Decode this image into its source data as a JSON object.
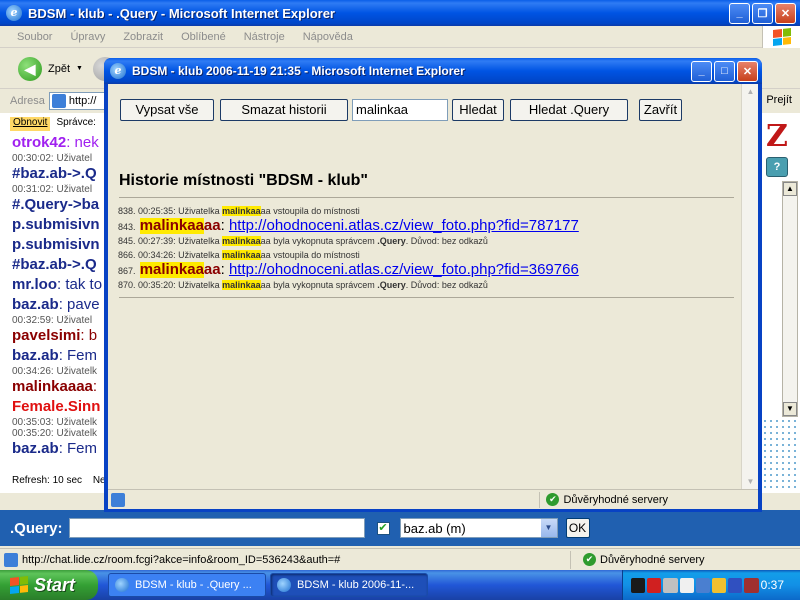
{
  "main_window": {
    "title": "BDSM - klub - .Query - Microsoft Internet Explorer",
    "menu": [
      "Soubor",
      "Úpravy",
      "Zobrazit",
      "Oblíbené",
      "Nástroje",
      "Nápověda"
    ],
    "back_label": "Zpět",
    "address_label": "Adresa",
    "address_value": "http://",
    "links_label": "Prejít",
    "chat_topbar": {
      "refresh_link": "Obnovit",
      "admin_link": "Správce:"
    },
    "chat_lines": [
      {
        "kind": "msg",
        "nick": "otrok42",
        "text": ": nek",
        "color": "#a020f0"
      },
      {
        "kind": "sys",
        "text": "00:30:02: Uživatel"
      },
      {
        "kind": "msg",
        "nick": "#baz.ab->.Q",
        "text": "",
        "color": "#1a2a8a"
      },
      {
        "kind": "sys",
        "text": "00:31:02: Uživatel"
      },
      {
        "kind": "msg",
        "nick": "#.Query->ba",
        "text": "",
        "color": "#1a2a8a"
      },
      {
        "kind": "msg",
        "nick": "p.submisivn",
        "text": "",
        "color": "#1a2a8a"
      },
      {
        "kind": "msg",
        "nick": "p.submisivn",
        "text": "",
        "color": "#1a2a8a"
      },
      {
        "kind": "msg",
        "nick": "#baz.ab->.Q",
        "text": "",
        "color": "#1a2a8a"
      },
      {
        "kind": "msg",
        "nick": "mr.loo",
        "text": ": tak to",
        "color": "#1a2a8a"
      },
      {
        "kind": "msg",
        "nick": "baz.ab",
        "text": ": pave",
        "color": "#1a2a8a"
      },
      {
        "kind": "sys",
        "text": "00:32:59: Uživatel"
      },
      {
        "kind": "msg",
        "nick": "pavelsimi",
        "text": ": b",
        "color": "#8a0000"
      },
      {
        "kind": "msg",
        "nick": "baz.ab",
        "text": ": Fem",
        "color": "#1a2a8a"
      },
      {
        "kind": "sys",
        "text": "00:34:26: Uživatelk"
      },
      {
        "kind": "msg",
        "nick": "malinkaaaa",
        "text": ":",
        "color": "#8a0000"
      },
      {
        "kind": "msg",
        "nick": "Female.Sinn",
        "text": "",
        "color": "#e01010"
      },
      {
        "kind": "sys",
        "text": "00:35:03: Uživatelk"
      },
      {
        "kind": "sys",
        "text": "00:35:20: Uživatelk"
      },
      {
        "kind": "msg",
        "nick": "baz.ab",
        "text": ": Fem",
        "color": "#1a2a8a"
      }
    ],
    "refresh_text": "Refresh: 10 sec",
    "refresh_extra": "Ne",
    "input_bar": {
      "label": ".Query:",
      "message_value": "",
      "recipient_selected": "baz.ab (m)",
      "ok_label": "OK"
    },
    "status_url": "http://chat.lide.cz/room.fcgi?akce=info&room_ID=536243&auth=#",
    "status_trust": "Důvěryhodné servery"
  },
  "popup": {
    "title": "BDSM - klub 2006-11-19 21:35 - Microsoft Internet Explorer",
    "buttons": {
      "list_all": "Vypsat vše",
      "clear_history": "Smazat historii",
      "search": "Hledat",
      "search_query": "Hledat .Query",
      "close": "Zavřít"
    },
    "search_value": "malinkaa",
    "heading": "Historie místnosti \"BDSM - klub\"",
    "history": [
      {
        "kind": "sys",
        "num": "838.",
        "time": "00:25:35:",
        "pre": "Uživatelka",
        "hi": "malinkaa",
        "rest": "aa",
        "post": "vstoupila do místnosti",
        "query": "",
        "tail": ""
      },
      {
        "kind": "msg",
        "num": "843.",
        "hi": "malinkaa",
        "rest": "aa",
        "url": "http://ohodnoceni.atlas.cz/view_foto.php?fid=787177"
      },
      {
        "kind": "sys",
        "num": "845.",
        "time": "00:27:39:",
        "pre": "Uživatelka",
        "hi": "malinkaa",
        "rest": "aa",
        "post": "byla vykopnuta správcem",
        "query": ".Query",
        "tail": ". Důvod: bez odkazů"
      },
      {
        "kind": "sys",
        "num": "866.",
        "time": "00:34:26:",
        "pre": "Uživatelka",
        "hi": "malinkaa",
        "rest": "aa",
        "post": "vstoupila do místnosti",
        "query": "",
        "tail": ""
      },
      {
        "kind": "msg",
        "num": "867.",
        "hi": "malinkaa",
        "rest": "aa",
        "url": "http://ohodnoceni.atlas.cz/view_foto.php?fid=369766"
      },
      {
        "kind": "sys",
        "num": "870.",
        "time": "00:35:20:",
        "pre": "Uživatelka",
        "hi": "malinkaa",
        "rest": "aa",
        "post": "byla vykopnuta správcem",
        "query": ".Query",
        "tail": ". Důvod: bez odkazů"
      }
    ],
    "status_trust": "Důvěryhodné servery"
  },
  "taskbar": {
    "start_label": "Start",
    "tasks": [
      "BDSM - klub - .Query ...",
      "BDSM - klub 2006-11-..."
    ],
    "clock": "0:37"
  }
}
